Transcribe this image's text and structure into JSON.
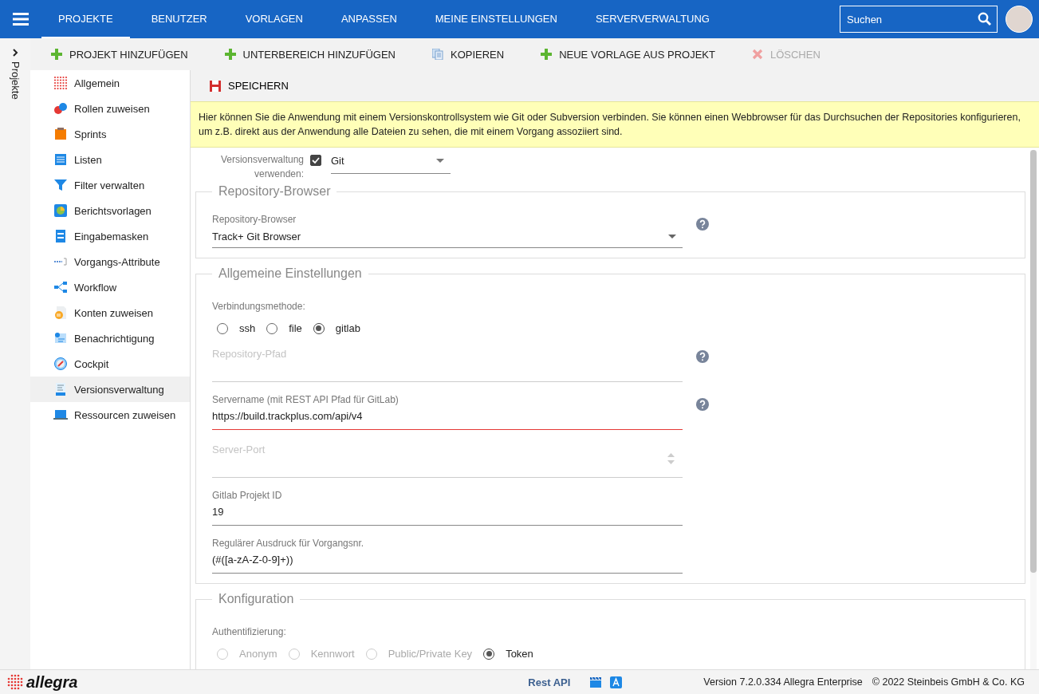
{
  "topbar": {
    "tabs": [
      {
        "label": "PROJEKTE",
        "selected": true
      },
      {
        "label": "BENUTZER",
        "selected": false
      },
      {
        "label": "VORLAGEN",
        "selected": false
      },
      {
        "label": "ANPASSEN",
        "selected": false
      },
      {
        "label": "MEINE EINSTELLUNGEN",
        "selected": false
      },
      {
        "label": "SERVERVERWALTUNG",
        "selected": false
      }
    ],
    "search": {
      "placeholder": "Suchen"
    }
  },
  "toolbar": {
    "buttons": [
      {
        "label": "PROJEKT HINZUFÜGEN",
        "disabled": false
      },
      {
        "label": "UNTERBEREICH HINZUFÜGEN",
        "disabled": false
      },
      {
        "label": "KOPIEREN",
        "disabled": false
      },
      {
        "label": "NEUE VORLAGE AUS PROJEKT",
        "disabled": false
      },
      {
        "label": "LÖSCHEN",
        "disabled": true
      }
    ]
  },
  "side_strip": {
    "label": "Projekte"
  },
  "sidebar": {
    "items": [
      {
        "label": "Allgemein",
        "selected": false
      },
      {
        "label": "Rollen zuweisen",
        "selected": false
      },
      {
        "label": "Sprints",
        "selected": false
      },
      {
        "label": "Listen",
        "selected": false
      },
      {
        "label": "Filter verwalten",
        "selected": false
      },
      {
        "label": "Berichtsvorlagen",
        "selected": false
      },
      {
        "label": "Eingabemasken",
        "selected": false
      },
      {
        "label": "Vorgangs-Attribute",
        "selected": false
      },
      {
        "label": "Workflow",
        "selected": false
      },
      {
        "label": "Konten zuweisen",
        "selected": false
      },
      {
        "label": "Benachrichtigung",
        "selected": false
      },
      {
        "label": "Cockpit",
        "selected": false
      },
      {
        "label": "Versionsverwaltung",
        "selected": true
      },
      {
        "label": "Ressourcen zuweisen",
        "selected": false
      }
    ]
  },
  "save_button": "SPEICHERN",
  "info": "Hier können Sie die Anwendung mit einem Versionskontrollsystem wie Git oder Subversion verbinden. Sie können einen Webbrowser für das Durchsuchen der Repositories konfigurieren, um z.B. direkt aus der Anwendung alle Dateien zu sehen, die mit einem Vorgang assoziiert sind.",
  "use_vcs": {
    "label": "Versionsverwaltung verwenden:",
    "checked": true,
    "value": "Git"
  },
  "sections": [
    {
      "title": "Repository-Browser",
      "fields": [
        {
          "kind": "select",
          "label": "Repository-Browser",
          "value": "Track+ Git Browser",
          "help": true
        }
      ]
    },
    {
      "title": "Allgemeine Einstellungen",
      "fields": [
        {
          "kind": "radio",
          "label": "Verbindungsmethode:",
          "options": [
            {
              "label": "ssh",
              "selected": false,
              "disabled": false
            },
            {
              "label": "file",
              "selected": false,
              "disabled": false
            },
            {
              "label": "gitlab",
              "selected": true,
              "disabled": false
            }
          ]
        },
        {
          "kind": "text",
          "placeholder": "Repository-Pfad",
          "help": true,
          "invalid": false
        },
        {
          "kind": "text",
          "label": "Servername (mit REST API Pfad für GitLab)",
          "value": "https://build.trackplus.com/api/v4",
          "help": true,
          "invalid": true
        },
        {
          "kind": "number",
          "placeholder": "Server-Port",
          "help": false,
          "invalid": false
        },
        {
          "kind": "text",
          "label": "Gitlab Projekt ID",
          "value": "19",
          "help": false,
          "invalid": false
        },
        {
          "kind": "text",
          "label": "Regulärer Ausdruck für Vorgangsnr.",
          "value": "(#([a-zA-Z-0-9]+))",
          "help": false,
          "invalid": false
        }
      ]
    },
    {
      "title": "Konfiguration",
      "fields": [
        {
          "kind": "radio",
          "label": "Authentifizierung:",
          "options": [
            {
              "label": "Anonym",
              "selected": false,
              "disabled": true
            },
            {
              "label": "Kennwort",
              "selected": false,
              "disabled": true
            },
            {
              "label": "Public/Private Key",
              "selected": false,
              "disabled": true
            },
            {
              "label": "Token",
              "selected": true,
              "disabled": false
            }
          ]
        }
      ]
    }
  ],
  "footer": {
    "logo": "allegra",
    "link": "Rest API",
    "version": "Version 7.2.0.334 Allegra Enterprise",
    "copyright": "© 2022 Steinbeis GmbH & Co. KG"
  }
}
